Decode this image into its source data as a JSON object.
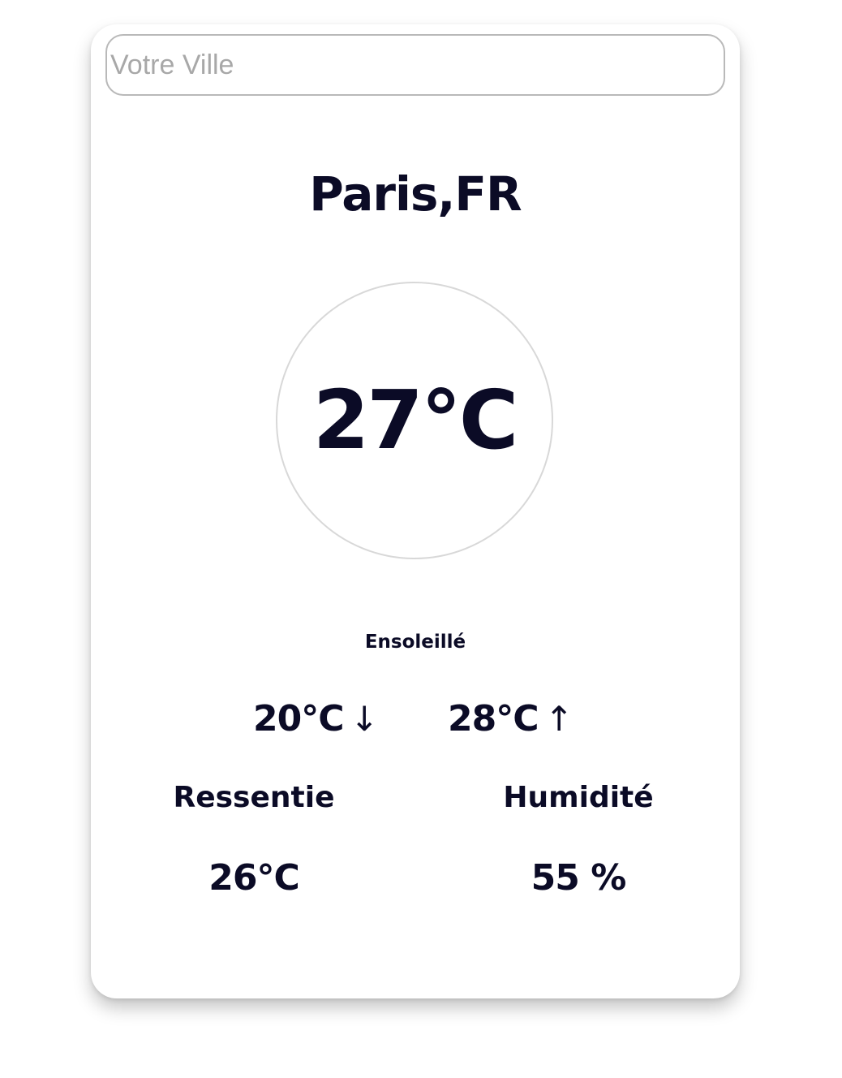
{
  "search": {
    "placeholder": "Votre Ville",
    "value": ""
  },
  "weather": {
    "city": "Paris,FR",
    "temperature": "27°C",
    "condition": "Ensoleillé",
    "min_temp": "20°C",
    "max_temp": "28°C",
    "min_arrow": "↓",
    "max_arrow": "↑"
  },
  "details": {
    "feels_like_label": "Ressentie",
    "feels_like_value": "26°C",
    "humidity_label": "Humidité",
    "humidity_value": "55 %"
  },
  "icons": {
    "min": "arrow-down-icon",
    "max": "arrow-up-icon"
  },
  "colors": {
    "text": "#0b0b26",
    "placeholder": "#a8a8a8",
    "input_border": "#b9b9b9",
    "circle_border": "#d8d8d8",
    "card_background": "#ffffff"
  }
}
